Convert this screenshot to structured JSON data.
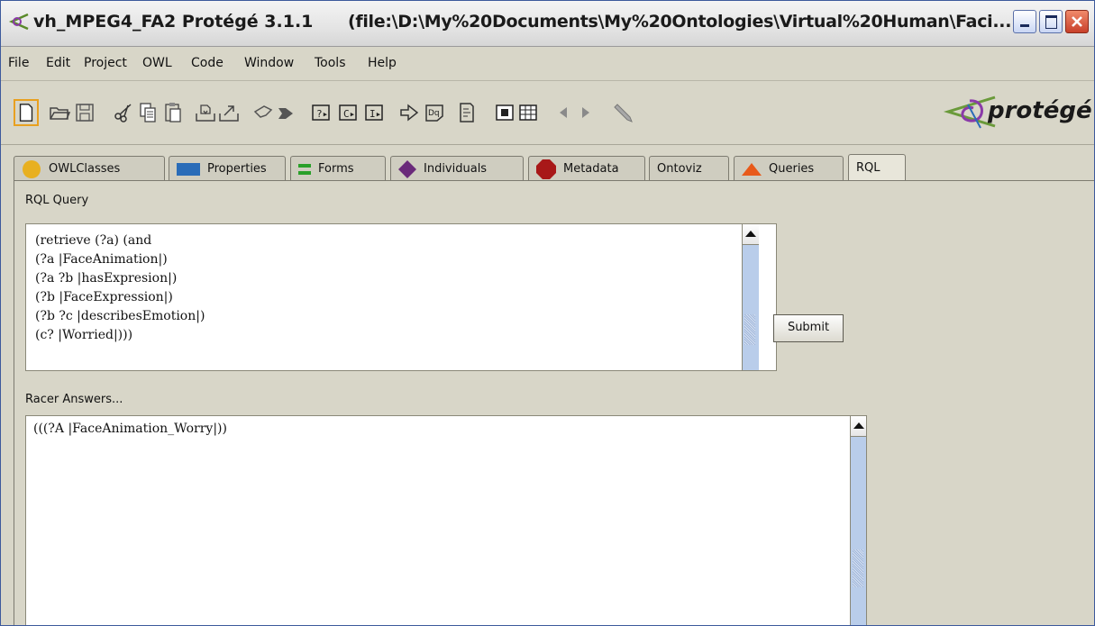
{
  "window": {
    "title": "vh_MPEG4_FA2  Protégé 3.1.1",
    "path": "(file:\\D:\\My%20Documents\\My%20Ontologies\\Virtual%20Human\\Faci..."
  },
  "menu": [
    "File",
    "Edit",
    "Project",
    "OWL",
    "Code",
    "Window",
    "Tools",
    "Help"
  ],
  "toolbar": {
    "icons": [
      "new-file-icon",
      "open-folder-icon",
      "save-icon",
      "cut-icon",
      "copy-icon",
      "paste-icon",
      "import-icon",
      "export-icon",
      "undo-icon",
      "redo-icon",
      "query-icon-1",
      "query-icon-2",
      "query-icon-3",
      "run-icon",
      "dq-icon",
      "document-icon",
      "classify-icon",
      "table-icon",
      "back-icon",
      "forward-icon",
      "pencil-icon"
    ],
    "logo_text": "protégé"
  },
  "tabs": [
    {
      "label": "OWLClasses",
      "color": "#e8b020",
      "icon": "circle"
    },
    {
      "label": "Properties",
      "color": "#2a6cb8",
      "icon": "rect"
    },
    {
      "label": "Forms",
      "color": "#2aa02a",
      "icon": "bars"
    },
    {
      "label": "Individuals",
      "color": "#6a2a7a",
      "icon": "diamond"
    },
    {
      "label": "Metadata",
      "color": "#a81818",
      "icon": "octagon"
    },
    {
      "label": "Ontoviz",
      "color": "",
      "icon": "none"
    },
    {
      "label": "Queries",
      "color": "#e85a1a",
      "icon": "triangle"
    },
    {
      "label": "RQL",
      "color": "",
      "icon": "none"
    }
  ],
  "rql": {
    "query_label": "RQL Query",
    "query_lines": [
      "(retrieve (?a) (and",
      "(?a |FaceAnimation|)",
      "(?a ?b |hasExpresion|)",
      "(?b |FaceExpression|)",
      "(?b ?c |describesEmotion|)",
      "(c? |Worried|)))"
    ],
    "submit_label": "Submit",
    "answers_label": "Racer Answers...",
    "answer_lines": [
      "(((?A |FaceAnimation_Worry|))"
    ]
  }
}
